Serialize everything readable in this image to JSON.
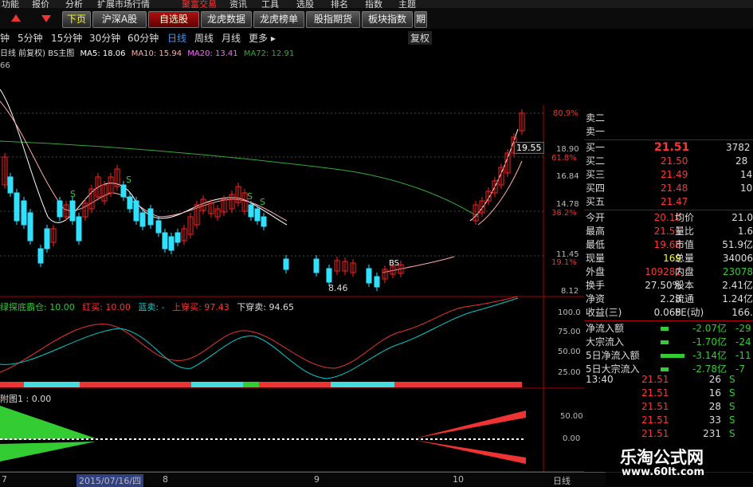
{
  "menu": {
    "items": [
      "功能",
      "报价",
      "分析",
      "扩展市场行情",
      "聚富交易",
      "资讯",
      "工具",
      "选股",
      "排名",
      "指数",
      "主题"
    ]
  },
  "toolbar": {
    "prev_label": "上页",
    "next_label": "下页",
    "market_label": "沪深A股",
    "watch_label": "自选股",
    "dragon_label": "龙虎数据",
    "dragon_list_label": "龙虎榜单",
    "futures_label": "股指期货",
    "sector_label": "板块指数",
    "extra_label": "期"
  },
  "periods": {
    "items": [
      "钟",
      "5分钟",
      "15分钟",
      "30分钟",
      "60分钟",
      "日线",
      "周线",
      "月线",
      "更多 ▸"
    ],
    "active": "日线",
    "restore_label": "复权"
  },
  "main_chart": {
    "header": "日线 前复权) BS主图",
    "ma5": "MA5: 18.06",
    "ma10": "MA10: 15.94",
    "ma20": "MA20: 13.41",
    "ma72": "MA72: 12.91",
    "price_top": "66",
    "price_axis": [
      "80.9%",
      "18.90",
      "61.8%",
      "16.84",
      "14.78",
      "38.2%",
      "11.45",
      "19.1%",
      "8.12"
    ],
    "last_price_tag": "19.55",
    "low_marker": "8.46",
    "annotation": "BS"
  },
  "quote": {
    "sell_rows": [
      {
        "label": "卖二",
        "price": "",
        "vol": ""
      },
      {
        "label": "卖一",
        "price": "",
        "vol": ""
      }
    ],
    "buy_rows": [
      {
        "label": "买一",
        "price": "21.51",
        "vol": "3782"
      },
      {
        "label": "买二",
        "price": "21.50",
        "vol": "28"
      },
      {
        "label": "买三",
        "price": "21.49",
        "vol": "14"
      },
      {
        "label": "买四",
        "price": "21.48",
        "vol": "10"
      },
      {
        "label": "买五",
        "price": "21.47",
        "vol": ""
      }
    ],
    "stats": [
      {
        "l1": "今开",
        "v1": "20.10",
        "l2": "均价",
        "v2": "21.0"
      },
      {
        "l1": "最高",
        "v1": "21.51",
        "l2": "量比",
        "v2": "1.6"
      },
      {
        "l1": "最低",
        "v1": "19.68",
        "l2": "市值",
        "v2": "51.9亿"
      },
      {
        "l1": "现量",
        "v1": "169",
        "l2": "总量",
        "v2": "34006"
      },
      {
        "l1": "外盘",
        "v1": "109281",
        "l2": "内盘",
        "v2": "23078"
      },
      {
        "l1": "换手",
        "v1": "27.50%",
        "l2": "股本",
        "v2": "2.41亿"
      },
      {
        "l1": "净资",
        "v1": "2.28",
        "l2": "流通",
        "v2": "1.24亿"
      },
      {
        "l1": "收益(三)",
        "v1": "0.065",
        "l2": "PE(动)",
        "v2": "166."
      }
    ],
    "flows": [
      {
        "label": "净流入额",
        "value": "-2.07亿",
        "extra": "-29"
      },
      {
        "label": "大宗流入",
        "value": "-1.70亿",
        "extra": "-24"
      },
      {
        "label": "5日净流入额",
        "value": "-3.14亿",
        "extra": "-11"
      },
      {
        "label": "5日大宗流入",
        "value": "-2.78亿",
        "extra": "-7"
      }
    ]
  },
  "ticks": [
    {
      "time": "13:40",
      "price": "21.51",
      "vol": "26",
      "flag": "S"
    },
    {
      "time": "",
      "price": "21.51",
      "vol": "16",
      "flag": "S"
    },
    {
      "time": "",
      "price": "21.51",
      "vol": "28",
      "flag": "S"
    },
    {
      "time": "",
      "price": "21.51",
      "vol": "33",
      "flag": "S"
    },
    {
      "time": "",
      "price": "21.51",
      "vol": "231",
      "flag": "S"
    }
  ],
  "indicator1": {
    "name": "绿探底霸仓: 10.00",
    "red": "红买: 10.00",
    "blue": "蓝卖: -",
    "up": "上穿买: 97.43",
    "down": "下穿卖: 94.65",
    "axis": [
      "100.0",
      "75.00",
      "50.00",
      "25.00"
    ]
  },
  "indicator2": {
    "name": "附图1 : 0.00",
    "axis": [
      "50.00",
      "0.00"
    ]
  },
  "bottom": {
    "dates": [
      "7",
      "2015/07/16/四",
      "8",
      "9",
      "10"
    ],
    "period": "日线"
  },
  "watermark": {
    "title": "乐淘公式网",
    "url": "www.60lt.com"
  },
  "colors": {
    "up": "#ff2020",
    "down": "#30e0ff",
    "ma5": "#ffffff",
    "ma10": "#ffaaaa",
    "ma20": "#ff66ff",
    "ma72": "#33aa33",
    "panel_border": "#a00000"
  }
}
